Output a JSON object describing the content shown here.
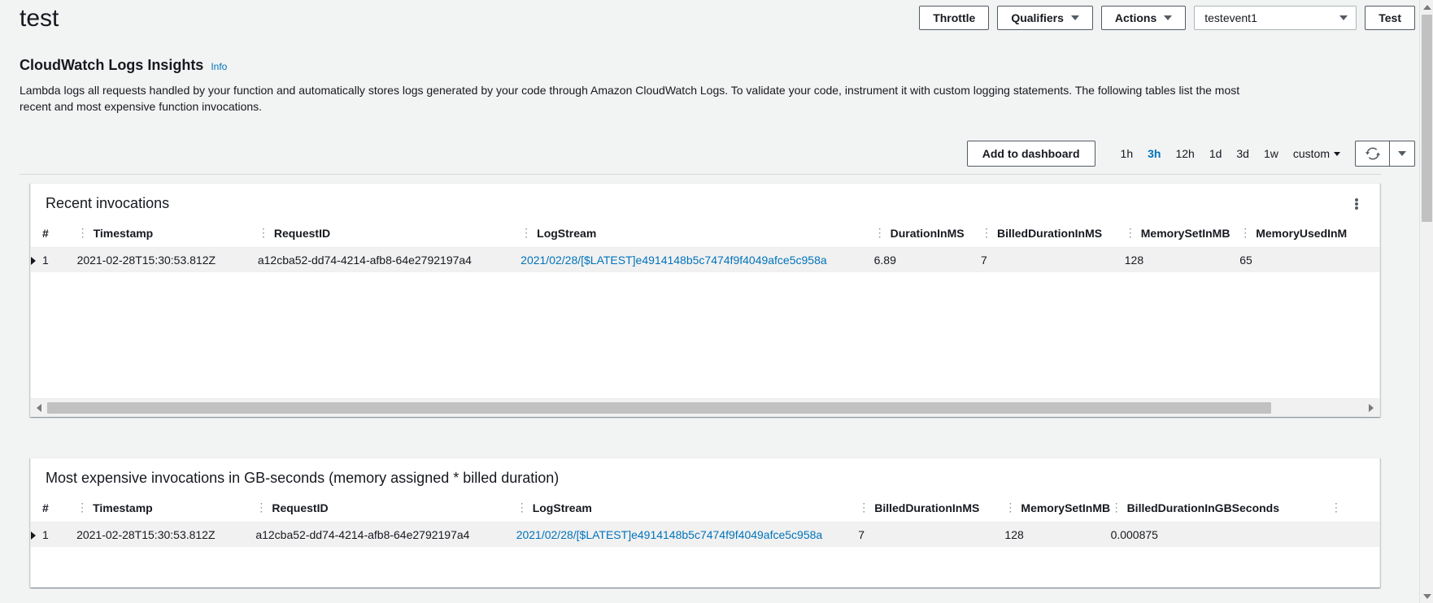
{
  "header": {
    "function_name": "test",
    "buttons": {
      "throttle": "Throttle",
      "qualifiers": "Qualifiers",
      "actions": "Actions",
      "test": "Test"
    },
    "event_select": {
      "value": "testevent1"
    }
  },
  "section": {
    "title": "CloudWatch Logs Insights",
    "info_label": "Info",
    "description": "Lambda logs all requests handled by your function and automatically stores logs generated by your code through Amazon CloudWatch Logs. To validate your code, instrument it with custom logging statements. The following tables list the most recent and most expensive function invocations."
  },
  "toolbar": {
    "add_to_dashboard": "Add to dashboard",
    "ranges": [
      "1h",
      "3h",
      "12h",
      "1d",
      "3d",
      "1w"
    ],
    "active_range": "3h",
    "custom_label": "custom",
    "refresh_icon": "refresh-icon",
    "refresh_caret_icon": "chevron-down-icon"
  },
  "colors": {
    "link": "#0073bb",
    "accent": "#0073bb",
    "text": "#16191f",
    "page_bg": "#f2f3f3",
    "panel_bg": "#ffffff",
    "row_bg": "#f1f1f1",
    "border": "#eaeded"
  },
  "recent_invocations": {
    "title": "Recent invocations",
    "menu_icon": "kebab-menu-icon",
    "columns": [
      "#",
      "Timestamp",
      "RequestID",
      "LogStream",
      "DurationInMS",
      "BilledDurationInMS",
      "MemorySetInMB",
      "MemoryUsedInM"
    ],
    "rows": [
      {
        "index": "1",
        "timestamp": "2021-02-28T15:30:53.812Z",
        "request_id": "a12cba52-dd74-4214-afb8-64e2792197a4",
        "log_stream": "2021/02/28/[$LATEST]e4914148b5c7474f9f4049afce5c958a",
        "duration_in_ms": "6.89",
        "billed_duration_in_ms": "7",
        "memory_set_in_mb": "128",
        "memory_used_in_mb": "65"
      }
    ]
  },
  "expensive_invocations": {
    "title": "Most expensive invocations in GB-seconds (memory assigned * billed duration)",
    "columns": [
      "#",
      "Timestamp",
      "RequestID",
      "LogStream",
      "BilledDurationInMS",
      "MemorySetInMB",
      "BilledDurationInGBSeconds"
    ],
    "rows": [
      {
        "index": "1",
        "timestamp": "2021-02-28T15:30:53.812Z",
        "request_id": "a12cba52-dd74-4214-afb8-64e2792197a4",
        "log_stream": "2021/02/28/[$LATEST]e4914148b5c7474f9f4049afce5c958a",
        "billed_duration_in_ms": "7",
        "memory_set_in_mb": "128",
        "billed_duration_in_gb_seconds": "0.000875"
      }
    ]
  }
}
